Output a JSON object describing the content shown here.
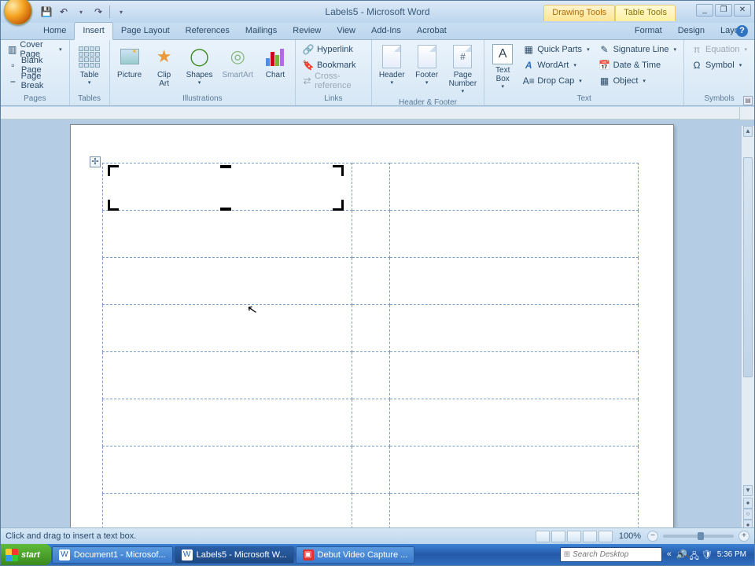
{
  "title": "Labels5 - Microsoft Word",
  "contextual_tabs": {
    "drawing": "Drawing Tools",
    "table": "Table Tools"
  },
  "tabs": [
    "Home",
    "Insert",
    "Page Layout",
    "References",
    "Mailings",
    "Review",
    "View",
    "Add-Ins",
    "Acrobat",
    "Format",
    "Design",
    "Layout"
  ],
  "active_tab": 1,
  "ribbon": {
    "pages": {
      "label": "Pages",
      "cover": "Cover Page",
      "blank": "Blank Page",
      "break": "Page Break"
    },
    "tables": {
      "label": "Tables",
      "table": "Table"
    },
    "illus": {
      "label": "Illustrations",
      "picture": "Picture",
      "clipart": "Clip\nArt",
      "shapes": "Shapes",
      "smartart": "SmartArt",
      "chart": "Chart"
    },
    "links": {
      "label": "Links",
      "hyper": "Hyperlink",
      "book": "Bookmark",
      "cross": "Cross-reference"
    },
    "hf": {
      "label": "Header & Footer",
      "header": "Header",
      "footer": "Footer",
      "pagenum": "Page\nNumber"
    },
    "text": {
      "label": "Text",
      "textbox": "Text\nBox",
      "quick": "Quick Parts",
      "wordart": "WordArt",
      "dropcap": "Drop Cap",
      "sig": "Signature Line",
      "date": "Date & Time",
      "obj": "Object"
    },
    "symbols": {
      "label": "Symbols",
      "eq": "Equation",
      "sym": "Symbol"
    }
  },
  "status": {
    "msg": "Click and drag to insert a text box.",
    "zoom": "100%"
  },
  "taskbar": {
    "start": "start",
    "items": [
      "Document1 - Microsof...",
      "Labels5 - Microsoft W...",
      "Debut Video Capture ..."
    ],
    "search_ph": "Search Desktop",
    "time": "5:36 PM"
  },
  "icons": {
    "save": "💾",
    "undo": "↶",
    "redo": "↷",
    "help": "?",
    "min": "_",
    "max": "❐",
    "close": "✕",
    "link": "🔗",
    "bookmark": "🔖",
    "cross": "⇄",
    "header": "▭",
    "footer": "▭",
    "num": "#",
    "textbox": "A",
    "quick": "▦",
    "wordart": "A",
    "drop": "A≡",
    "sig": "✎",
    "date": "📅",
    "obj": "▦",
    "eq": "π",
    "sym": "Ω",
    "plus": "✢",
    "mag": "🔍",
    "xp": "⊞",
    "chev": "«",
    "spk": "🔊",
    "net": "🖧"
  }
}
